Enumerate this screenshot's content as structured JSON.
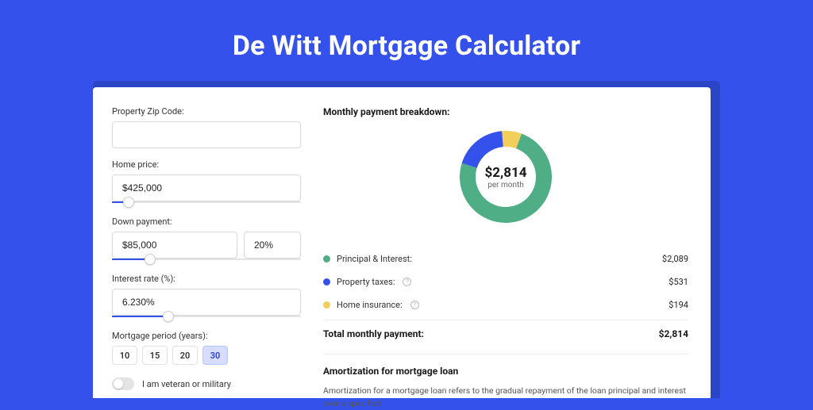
{
  "title": "De Witt Mortgage Calculator",
  "form": {
    "zip_label": "Property Zip Code:",
    "zip_value": "",
    "home_price_label": "Home price:",
    "home_price_value": "$425,000",
    "home_price_slider_pct": 9,
    "down_payment_label": "Down payment:",
    "down_payment_value": "$85,000",
    "down_payment_pct_value": "20%",
    "down_payment_slider_pct": 20,
    "interest_label": "Interest rate (%):",
    "interest_value": "6.230%",
    "interest_slider_pct": 30,
    "period_label": "Mortgage period (years):",
    "periods": [
      "10",
      "15",
      "20",
      "30"
    ],
    "period_selected": "30",
    "veteran_label": "I am veteran or military",
    "veteran_on": false
  },
  "breakdown": {
    "heading": "Monthly payment breakdown:",
    "center_amount": "$2,814",
    "center_sub": "per month",
    "items": [
      {
        "label": "Principal & Interest:",
        "value": "$2,089",
        "color": "#4fae86",
        "help": false
      },
      {
        "label": "Property taxes:",
        "value": "$531",
        "color": "#3452eb",
        "help": true
      },
      {
        "label": "Home insurance:",
        "value": "$194",
        "color": "#f2cf5b",
        "help": true
      }
    ],
    "total_label": "Total monthly payment:",
    "total_value": "$2,814"
  },
  "chart_data": {
    "type": "pie",
    "title": "Monthly payment breakdown",
    "categories": [
      "Principal & Interest",
      "Property taxes",
      "Home insurance"
    ],
    "values": [
      2089,
      531,
      194
    ],
    "series_colors": [
      "#4fae86",
      "#3452eb",
      "#f2cf5b"
    ],
    "total": 2814,
    "unit": "USD per month",
    "donut": true
  },
  "amortization": {
    "heading": "Amortization for mortgage loan",
    "text": "Amortization for a mortgage loan refers to the gradual repayment of the loan principal and interest over a specified"
  }
}
